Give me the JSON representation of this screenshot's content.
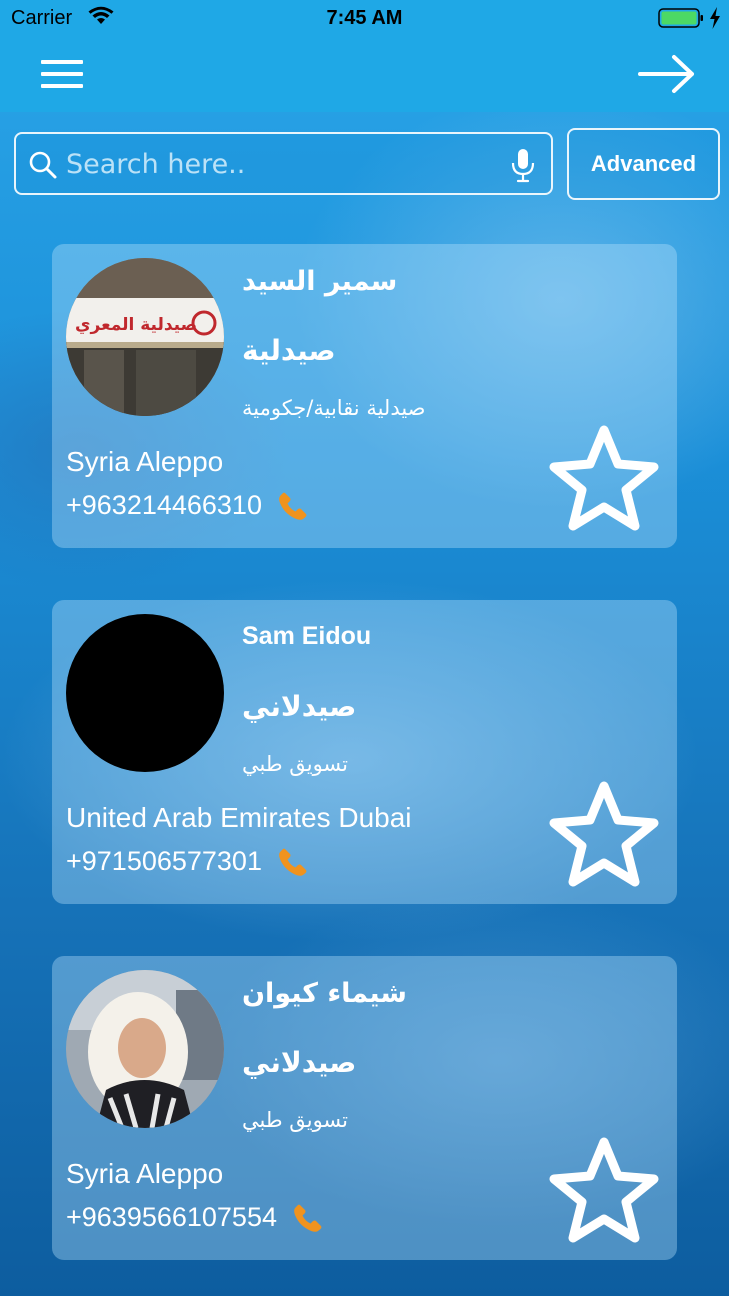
{
  "status_bar": {
    "carrier": "Carrier",
    "time": "7:45 AM"
  },
  "search": {
    "placeholder": "Search here..",
    "value": "",
    "advanced_label": "Advanced"
  },
  "colors": {
    "header_bg": "#1fa8e6",
    "phone_icon": "#f0931e",
    "battery_fill": "#4cd964"
  },
  "cards": [
    {
      "name": "سمير السيد",
      "role": "صيدلية",
      "category": "صيدلية نقابية/جكومية",
      "location": "Syria Aleppo",
      "phone": "+963214466310",
      "avatar_sign_text": "صيدلية المعري"
    },
    {
      "name": "Sam Eidou",
      "role": "صيدلاني",
      "category": "تسويق طبي",
      "location": "United Arab Emirates Dubai",
      "phone": "+971506577301"
    },
    {
      "name": "شيماء كيوان",
      "role": "صيدلاني",
      "category": "تسويق طبي",
      "location": "Syria Aleppo",
      "phone": "+9639566107554"
    }
  ]
}
